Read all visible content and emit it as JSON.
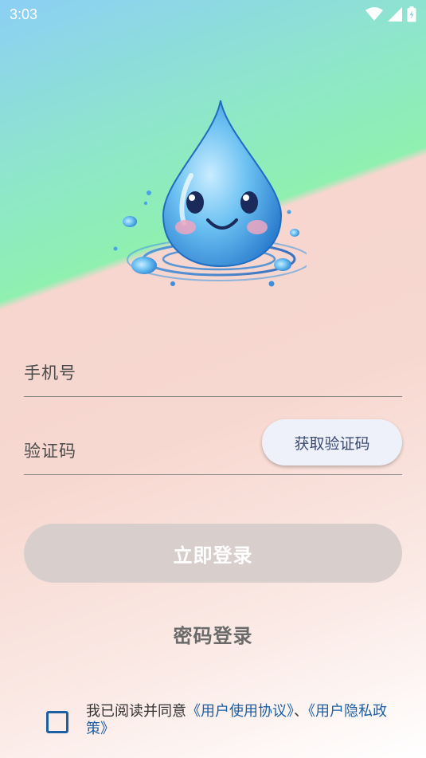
{
  "status_bar": {
    "time": "3:03",
    "icons": [
      "wifi-icon",
      "signal-icon",
      "battery-charging-icon"
    ]
  },
  "mascot": {
    "description_icon": "water-drop-mascot-icon",
    "colors": {
      "drop": "#5cb6ee",
      "drop_dark": "#2a7fd0",
      "cheek": "#f0a6c0"
    }
  },
  "form": {
    "phone_label": "手机号",
    "code_label": "验证码",
    "get_code_button": "获取验证码"
  },
  "actions": {
    "login_button": "立即登录",
    "password_login": "密码登录"
  },
  "agreement": {
    "prefix": "我已阅读并同意",
    "user_agreement": "《用户使用协议》",
    "separator": "、",
    "privacy_policy": "《用户隐私政策》",
    "checked": false
  },
  "colors": {
    "link": "#1c5fa3",
    "login_button_bg": "#d8cfcd",
    "code_button_bg": "#eef1fa"
  }
}
